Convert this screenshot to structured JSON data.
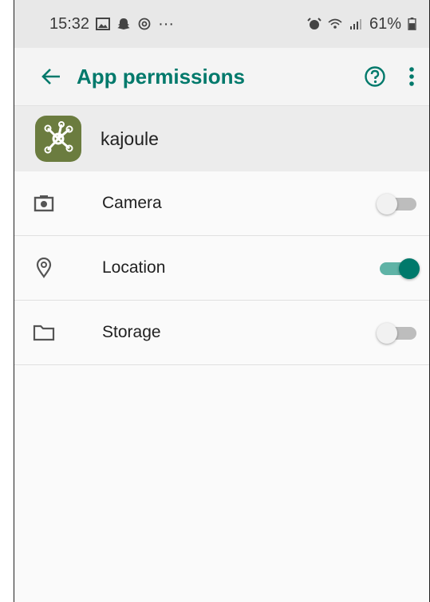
{
  "status_bar": {
    "time": "15:32",
    "dots": "···",
    "battery_text": "61%",
    "left_icons": [
      "gallery-icon",
      "snapchat-icon",
      "at-sign-icon"
    ],
    "right_icons": [
      "alarm-icon",
      "wifi-icon",
      "signal-icon",
      "battery-icon"
    ]
  },
  "app_bar": {
    "title": "App permissions",
    "back_icon": "arrow-back-icon",
    "help_icon": "help-circle-icon",
    "more_icon": "more-vertical-icon"
  },
  "app": {
    "name": "kajoule",
    "icon": "network-nodes-icon"
  },
  "permissions": [
    {
      "label": "Camera",
      "icon": "camera-icon",
      "enabled": false
    },
    {
      "label": "Location",
      "icon": "location-pin-icon",
      "enabled": true
    },
    {
      "label": "Storage",
      "icon": "folder-icon",
      "enabled": false
    }
  ],
  "colors": {
    "accent": "#00796b",
    "switch_on_track": "#5fb3a6",
    "switch_off_track": "#bdbdbd"
  }
}
